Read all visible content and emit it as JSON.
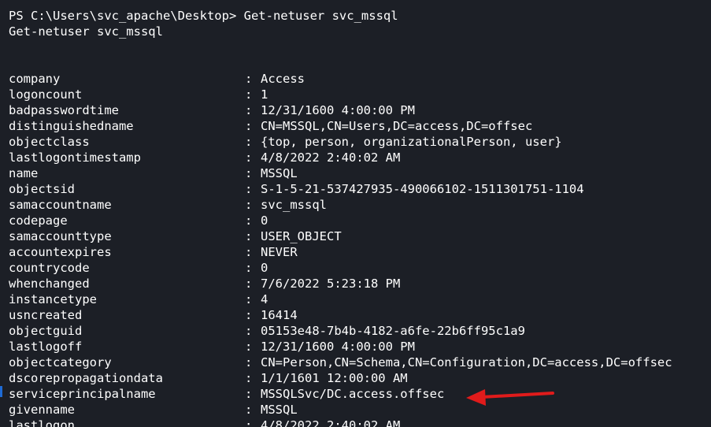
{
  "terminal": {
    "prompt_line": "PS C:\\Users\\svc_apache\\Desktop> Get-netuser svc_mssql",
    "echo_line": "Get-netuser svc_mssql",
    "separator": ":",
    "properties": [
      {
        "key": "company",
        "value": "Access"
      },
      {
        "key": "logoncount",
        "value": "1"
      },
      {
        "key": "badpasswordtime",
        "value": "12/31/1600 4:00:00 PM"
      },
      {
        "key": "distinguishedname",
        "value": "CN=MSSQL,CN=Users,DC=access,DC=offsec"
      },
      {
        "key": "objectclass",
        "value": "{top, person, organizationalPerson, user}"
      },
      {
        "key": "lastlogontimestamp",
        "value": "4/8/2022 2:40:02 AM"
      },
      {
        "key": "name",
        "value": "MSSQL"
      },
      {
        "key": "objectsid",
        "value": "S-1-5-21-537427935-490066102-1511301751-1104"
      },
      {
        "key": "samaccountname",
        "value": "svc_mssql"
      },
      {
        "key": "codepage",
        "value": "0"
      },
      {
        "key": "samaccounttype",
        "value": "USER_OBJECT"
      },
      {
        "key": "accountexpires",
        "value": "NEVER"
      },
      {
        "key": "countrycode",
        "value": "0"
      },
      {
        "key": "whenchanged",
        "value": "7/6/2022 5:23:18 PM"
      },
      {
        "key": "instancetype",
        "value": "4"
      },
      {
        "key": "usncreated",
        "value": "16414"
      },
      {
        "key": "objectguid",
        "value": "05153e48-7b4b-4182-a6fe-22b6ff95c1a9"
      },
      {
        "key": "lastlogoff",
        "value": "12/31/1600 4:00:00 PM"
      },
      {
        "key": "objectcategory",
        "value": "CN=Person,CN=Schema,CN=Configuration,DC=access,DC=offsec"
      },
      {
        "key": "dscorepropagationdata",
        "value": "1/1/1601 12:00:00 AM"
      },
      {
        "key": "serviceprincipalname",
        "value": "MSSQLSvc/DC.access.offsec"
      },
      {
        "key": "givenname",
        "value": "MSSQL"
      },
      {
        "key": "lastlogon",
        "value": "4/8/2022 2:40:02 AM"
      }
    ]
  },
  "annotation": {
    "arrow_icon": "red-arrow-icon",
    "arrow_color": "#e01b1b"
  },
  "colors": {
    "background": "#1c1f26",
    "text": "#ffffff"
  }
}
